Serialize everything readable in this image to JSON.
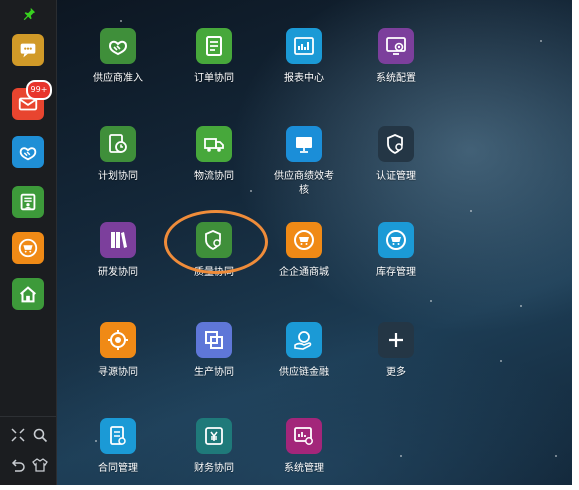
{
  "sidebar": {
    "items": [
      {
        "name": "chat-icon",
        "color": "#d19a28"
      },
      {
        "name": "mail-icon",
        "color": "#e8452f",
        "badge": "99+"
      },
      {
        "name": "handshake-icon",
        "color": "#1f8fd6"
      },
      {
        "name": "document-user-icon",
        "color": "#3d9a3a"
      },
      {
        "name": "cart-icon",
        "color": "#f08a16"
      },
      {
        "name": "home-icon",
        "color": "#3d9a3a"
      }
    ],
    "tools": [
      "expand-icon",
      "search-icon",
      "undo-icon",
      "shirt-icon"
    ]
  },
  "apps": [
    {
      "label": "供应商准入",
      "icon": "handshake-icon",
      "color": "#3f8f3a"
    },
    {
      "label": "订单协同",
      "icon": "order-list-icon",
      "color": "#47a83b"
    },
    {
      "label": "报表中心",
      "icon": "report-chart-icon",
      "color": "#1b9ad6"
    },
    {
      "label": "系统配置",
      "icon": "system-config-icon",
      "color": "#7c3f9c"
    },
    {
      "label": "计划协同",
      "icon": "plan-clock-icon",
      "color": "#3f8f3a"
    },
    {
      "label": "物流协同",
      "icon": "truck-icon",
      "color": "#47a83b"
    },
    {
      "label": "供应商绩效考核",
      "icon": "monitor-icon",
      "color": "#1b8ed8"
    },
    {
      "label": "认证管理",
      "icon": "shield-gear-icon",
      "color": "#243645"
    },
    {
      "label": "研发协同",
      "icon": "books-icon",
      "color": "#7c3f9c"
    },
    {
      "label": "质量协同",
      "icon": "quality-shield-icon",
      "color": "#3f8f3a"
    },
    {
      "label": "企企通商城",
      "icon": "mall-cart-icon",
      "color": "#f08a16"
    },
    {
      "label": "库存管理",
      "icon": "inventory-cart-icon",
      "color": "#1b9ad6"
    },
    {
      "label": "寻源协同",
      "icon": "target-icon",
      "color": "#f08a16"
    },
    {
      "label": "生产协同",
      "icon": "production-icon",
      "color": "#5f77d8"
    },
    {
      "label": "供应链金融",
      "icon": "finance-hand-icon",
      "color": "#1b9ad6"
    },
    {
      "label": "更多",
      "icon": "plus-icon",
      "color": "#243645"
    },
    {
      "label": "合同管理",
      "icon": "contract-icon",
      "color": "#1b9ad6"
    },
    {
      "label": "财务协同",
      "icon": "finance-yuan-icon",
      "color": "#1f7a7a"
    },
    {
      "label": "系统管理",
      "icon": "system-manage-icon",
      "color": "#a3267a"
    }
  ],
  "highlight": {
    "target": "质量协同",
    "color": "#ef8c3a"
  }
}
